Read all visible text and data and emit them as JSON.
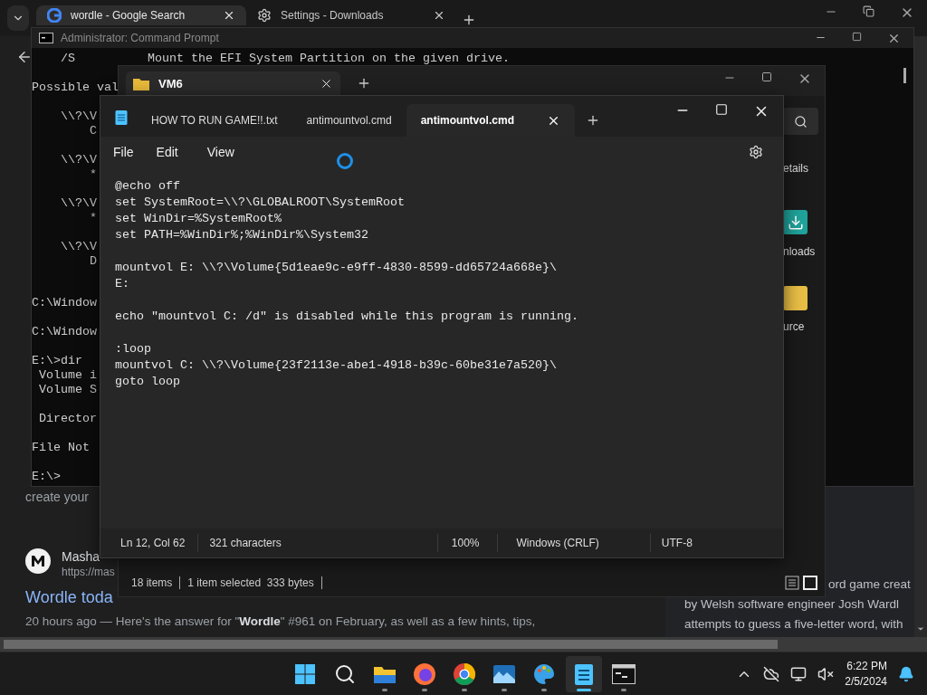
{
  "browser": {
    "tabs": [
      {
        "title": "wordle - Google Search",
        "kind": "google",
        "selected": true
      },
      {
        "title": "Settings - Downloads",
        "kind": "settings",
        "selected": false
      }
    ],
    "page": {
      "fragment": "create your",
      "result": {
        "site": "Masha",
        "url": "https://mas"
      },
      "headline": "Wordle toda",
      "snippet": "20 hours ago — Here's the answer for \"**Wordle**\" #961 on February, as well as a few hints, tips,"
    },
    "side_panel": [
      "ord game creat",
      "by Welsh software engineer Josh Wardl",
      "attempts to guess a five-letter word, with"
    ]
  },
  "cmd": {
    "title": "Administrator: Command Prompt",
    "upper": [
      [
        "    /S          Mount the EFI System Partition on the given drive."
      ],
      [
        "Possible val"
      ],
      [
        "    \\\\?\\V",
        "        C"
      ],
      [
        "    \\\\?\\V",
        "        *"
      ],
      [
        "    \\\\?\\V",
        "        *"
      ],
      [
        "    \\\\?\\V",
        "        D"
      ]
    ],
    "lower": [
      [
        "C:\\Window"
      ],
      [
        "C:\\Window"
      ],
      [
        "E:\\>dir",
        " Volume i",
        " Volume S"
      ],
      [
        " Director"
      ],
      [
        "File Not"
      ],
      [
        "E:\\>"
      ]
    ]
  },
  "explorer": {
    "tab": "VM6",
    "command": "etails",
    "items": [
      {
        "label": "nloads",
        "kind": "download"
      },
      {
        "label": "urce",
        "kind": "folder"
      }
    ],
    "status": [
      "18 items",
      "1 item selected  333 bytes"
    ]
  },
  "notepad": {
    "tabs": [
      {
        "title": "HOW TO RUN GAME!!.txt",
        "selected": false
      },
      {
        "title": "antimountvol.cmd",
        "selected": false
      },
      {
        "title": "antimountvol.cmd",
        "selected": true
      }
    ],
    "menu": [
      "File",
      "Edit",
      "View"
    ],
    "blocks": [
      [
        "@echo off",
        "set SystemRoot=\\\\?\\GLOBALROOT\\SystemRoot",
        "set WinDir=%SystemRoot%",
        "set PATH=%WinDir%;%WinDir%\\System32"
      ],
      [
        "mountvol E: \\\\?\\Volume{5d1eae9c-e9ff-4830-8599-dd65724a668e}\\",
        "E:"
      ],
      [
        "echo \"mountvol C: /d\" is disabled while this program is running."
      ],
      [
        ":loop",
        "mountvol C: \\\\?\\Volume{23f2113e-abe1-4918-b39c-60be31e7a520}\\",
        "goto loop"
      ]
    ],
    "status": [
      "Ln 12, Col 62",
      "321 characters",
      "100%",
      "Windows (CRLF)",
      "UTF-8"
    ]
  },
  "taskbar": {
    "apps": [
      {
        "kind": "start",
        "running": false,
        "active": false
      },
      {
        "kind": "search",
        "running": false,
        "active": false
      },
      {
        "kind": "explorer",
        "running": true,
        "active": false
      },
      {
        "kind": "firefox",
        "running": true,
        "active": false
      },
      {
        "kind": "chrome",
        "running": true,
        "active": false
      },
      {
        "kind": "photos",
        "running": true,
        "active": false
      },
      {
        "kind": "paint",
        "running": true,
        "active": false
      },
      {
        "kind": "notepad",
        "running": true,
        "active": true
      },
      {
        "kind": "terminal",
        "running": true,
        "active": false
      }
    ],
    "time": "6:22 PM",
    "date": "2/5/2024"
  }
}
